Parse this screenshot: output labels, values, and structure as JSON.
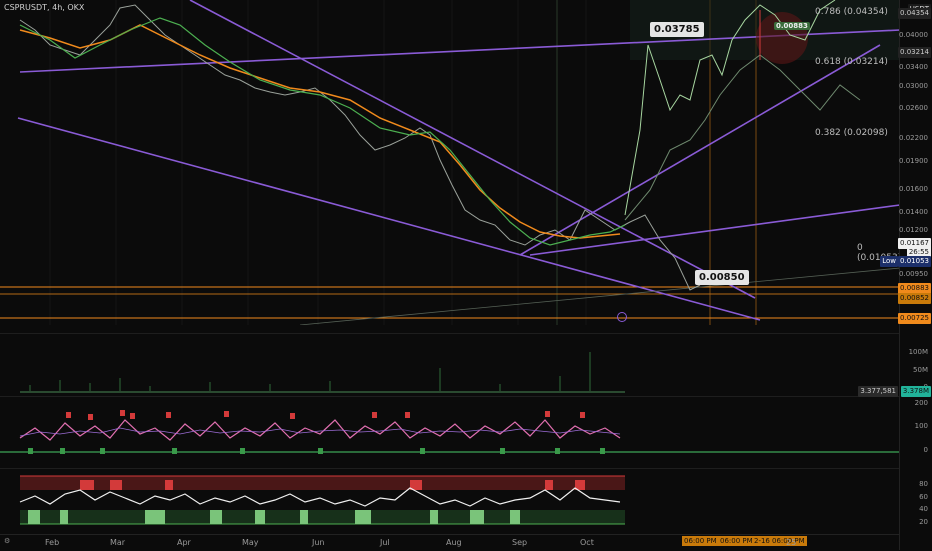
{
  "header": {
    "symbol": "CSPRUSDT, 4h, OKX"
  },
  "price_axis": {
    "currency": "USDT",
    "ticks": [
      "0.04000",
      "0.03400",
      "0.03000",
      "0.02600",
      "0.02200",
      "0.01900",
      "0.01600",
      "0.01400",
      "0.01200",
      "0.00950"
    ],
    "tags": {
      "fib786": "0.04354",
      "fib618": "0.03214",
      "current": "0.01167",
      "countdown": "26:55",
      "low_label": "Low",
      "low_value": "0.01053",
      "orange1": "0.00883",
      "orange2": "0.00852",
      "orange3": "0.00725"
    }
  },
  "fib_labels": {
    "f786": "0.786 (0.04354)",
    "f618": "0.618 (0.03214)",
    "f382": "0.382 (0.02098)",
    "f0": "0 (0.01053)"
  },
  "callouts": {
    "high": "0.03785",
    "low": "0.00850",
    "small": "0.00883"
  },
  "volume_axis": {
    "ticks": [
      "100M",
      "50M",
      "0"
    ],
    "tag_a": "3.377,581",
    "tag_b": "3.378M"
  },
  "osc1_axis": {
    "ticks": [
      "200",
      "100",
      "0"
    ]
  },
  "osc2_axis": {
    "ticks": [
      "80",
      "60",
      "40",
      "20"
    ]
  },
  "time_axis": {
    "labels": [
      "Feb",
      "Mar",
      "Apr",
      "May",
      "Jun",
      "Jul",
      "Aug",
      "Sep",
      "Oct"
    ],
    "highlighted": [
      "06:00 PM",
      "06:00 PM",
      "2-16",
      "06:00 PM"
    ],
    "suffix": "25"
  },
  "colors": {
    "purple": "#8a5bd6",
    "orange": "#f08a1c",
    "green": "#4caf50",
    "pink": "#e06fb0",
    "red": "#d33a3a"
  }
}
